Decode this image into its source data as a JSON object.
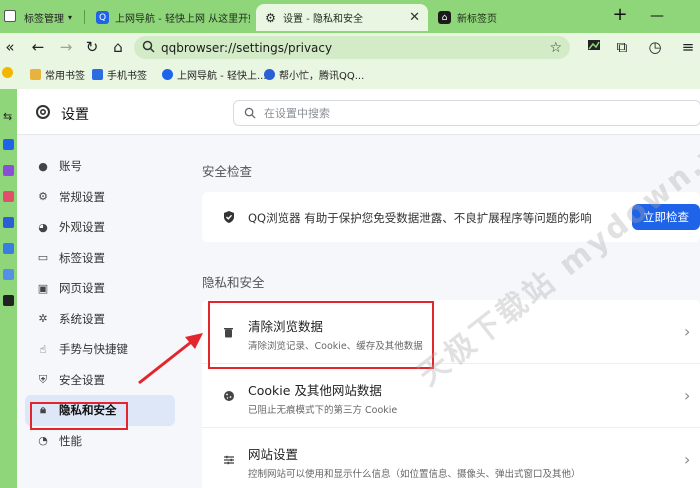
{
  "tabs": {
    "group_label": "标签管理",
    "items": [
      {
        "label": "上网导航 - 轻快上网 从这里开始",
        "active": false
      },
      {
        "label": "设置 - 隐私和安全",
        "active": true
      },
      {
        "label": "新标签页",
        "active": false
      }
    ],
    "close_glyph": "✕",
    "new_tab_glyph": "+",
    "minimize_glyph": "—"
  },
  "navbar": {
    "url": "qqbrowser://settings/privacy"
  },
  "bookmarks": [
    {
      "label": "常用书签"
    },
    {
      "label": "手机书签"
    },
    {
      "label": "上网导航 - 轻快上..."
    },
    {
      "label": "帮小忙，腾讯QQ..."
    }
  ],
  "header": {
    "title": "设置",
    "search_placeholder": "在设置中搜索"
  },
  "sidebar": {
    "items": [
      {
        "label": "账号",
        "icon": "person-icon"
      },
      {
        "label": "常规设置",
        "icon": "gear-icon"
      },
      {
        "label": "外观设置",
        "icon": "palette-icon"
      },
      {
        "label": "标签设置",
        "icon": "tab-icon"
      },
      {
        "label": "网页设置",
        "icon": "webpage-icon"
      },
      {
        "label": "系统设置",
        "icon": "wrench-icon"
      },
      {
        "label": "手势与快捷键",
        "icon": "hand-icon"
      },
      {
        "label": "安全设置",
        "icon": "shield-icon"
      },
      {
        "label": "隐私和安全",
        "icon": "lock-icon",
        "active": true
      },
      {
        "label": "性能",
        "icon": "gauge-icon"
      }
    ]
  },
  "safety": {
    "section_title": "安全检查",
    "description": "QQ浏览器 有助于保护您免受数据泄露、不良扩展程序等问题的影响",
    "button": "立即检查"
  },
  "privacy": {
    "section_title": "隐私和安全",
    "rows": [
      {
        "title": "清除浏览数据",
        "subtitle": "清除浏览记录、Cookie、缓存及其他数据",
        "icon": "trash-icon"
      },
      {
        "title": "Cookie 及其他网站数据",
        "subtitle": "已阻止无痕模式下的第三方 Cookie",
        "icon": "cookie-icon"
      },
      {
        "title": "网站设置",
        "subtitle": "控制网站可以使用和显示什么信息（如位置信息、摄像头、弹出式窗口及其他）",
        "icon": "sliders-icon"
      }
    ]
  },
  "watermark": "天极下载站 mydown.yesky.com",
  "colors": {
    "chrome_green": "#8fd67a",
    "toolbar_bg": "#e9f6e2",
    "primary_button": "#1f63e8",
    "annotation_red": "#e3262e",
    "active_item_bg": "#dde7f7"
  }
}
